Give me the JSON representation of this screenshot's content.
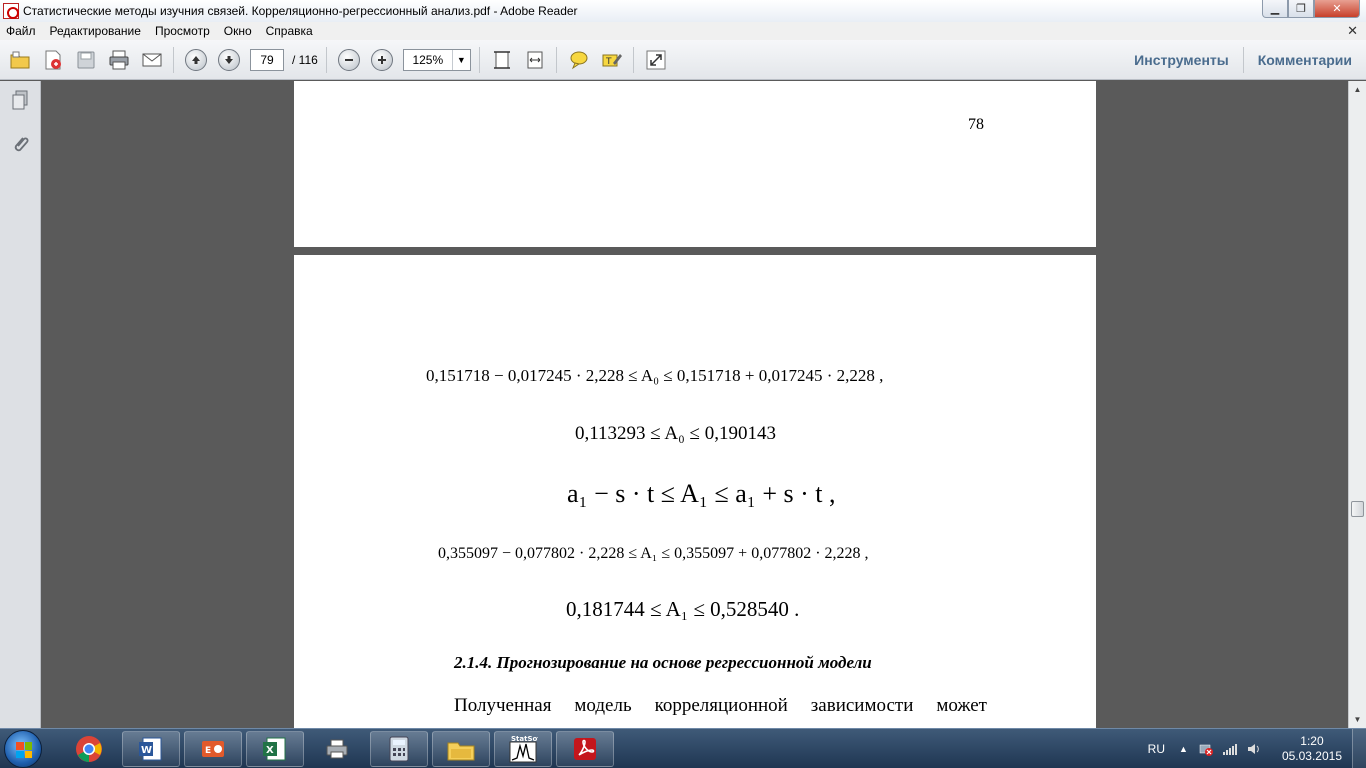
{
  "window": {
    "title": "Статистические методы изучния связей. Корреляционно-регрессионный анализ.pdf - Adobe Reader",
    "minimize_glyph": "▁",
    "maximize_glyph": "❐",
    "close_glyph": "✕"
  },
  "menu": {
    "items": [
      "Файл",
      "Редактирование",
      "Просмотр",
      "Окно",
      "Справка"
    ],
    "close_glyph": "✕"
  },
  "toolbar": {
    "current_page": "79",
    "total_pages": "/ 116",
    "zoom": "125%",
    "tools_label": "Инструменты",
    "comments_label": "Комментарии"
  },
  "document": {
    "prev_page_number": "78",
    "formulas": {
      "f1": "0,151718 − 0,017245 · 2,228 ≤ A₀ ≤ 0,151718 + 0,017245 · 2,228 ,",
      "f2": "0,113293 ≤ A₀ ≤ 0,190143",
      "f3": "a₁ − s · t ≤ A₁ ≤ a₁ + s · t ,",
      "f4": "0,355097 − 0,077802 · 2,228 ≤ A₁ ≤ 0,355097 + 0,077802 · 2,228 ,",
      "f5": "0,181744 ≤ A₁ ≤ 0,528540 ."
    },
    "heading": "2.1.4. Прогнозирование на основе регрессионной модели",
    "paragraph": "Полученная модель корреляционной зависимости может"
  },
  "taskbar": {
    "language": "RU",
    "time": "1:20",
    "date": "05.03.2015",
    "statsoft_label": "StatSoft"
  },
  "colors": {
    "accent_link": "#4a6c8e",
    "doc_background": "#5a5a5a",
    "taskbar": "#2a4565"
  }
}
